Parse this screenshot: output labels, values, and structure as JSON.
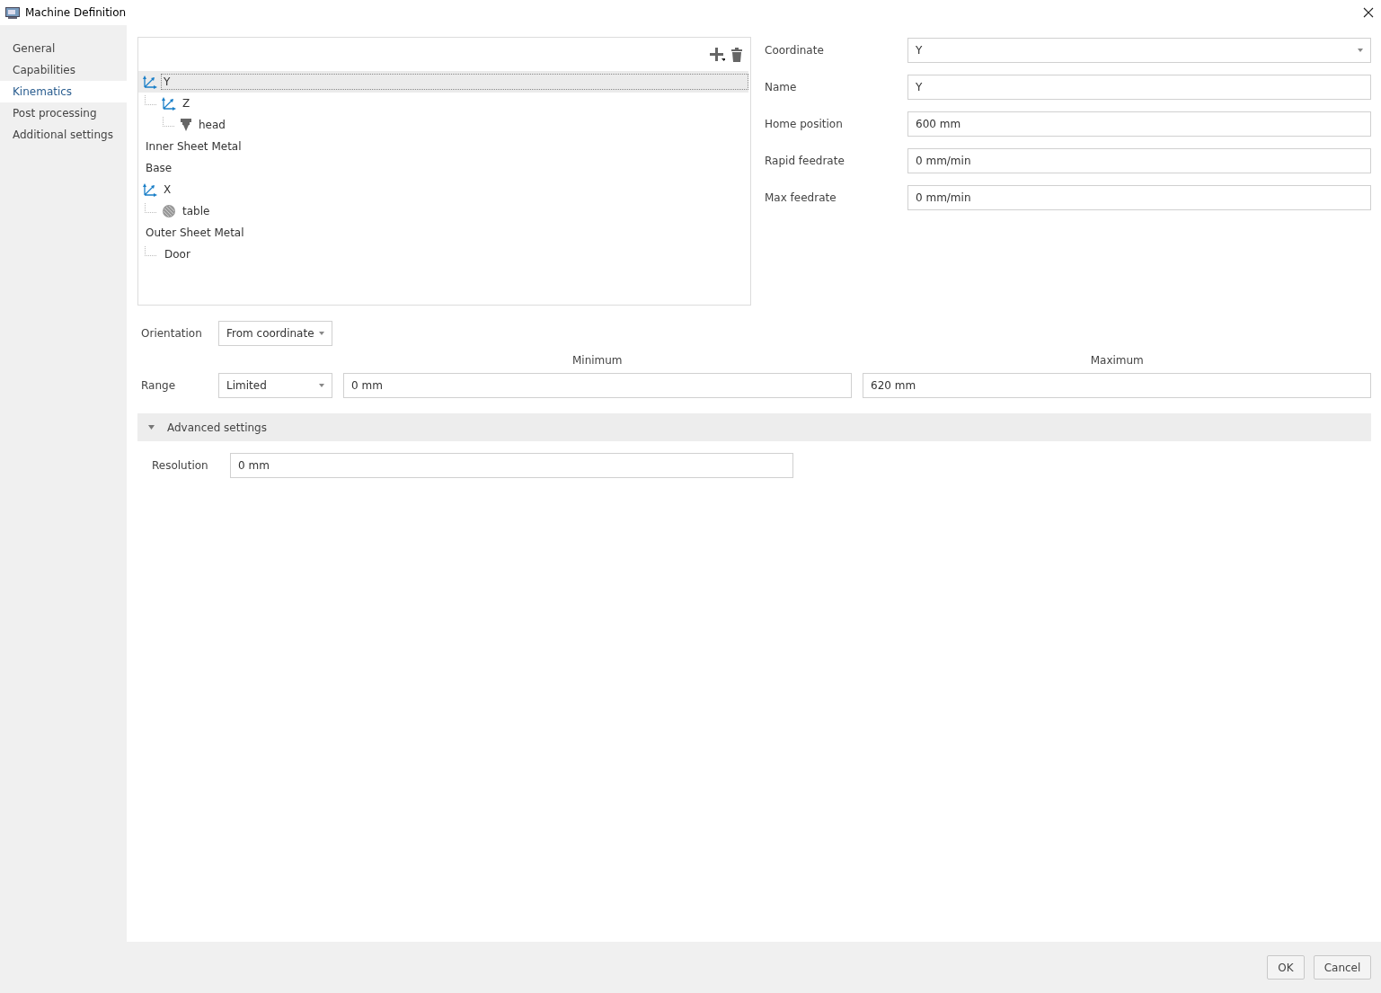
{
  "window": {
    "title": "Machine Definition"
  },
  "sidebar": {
    "items": [
      {
        "label": "General",
        "selected": false
      },
      {
        "label": "Capabilities",
        "selected": false
      },
      {
        "label": "Kinematics",
        "selected": true
      },
      {
        "label": "Post processing",
        "selected": false
      },
      {
        "label": "Additional settings",
        "selected": false
      }
    ]
  },
  "tree": {
    "items": [
      {
        "label": "Y",
        "kind": "axis",
        "selected": true,
        "children": [
          {
            "label": "Z",
            "kind": "axis",
            "selected": false,
            "children": [
              {
                "label": "head",
                "kind": "head",
                "selected": false
              }
            ]
          }
        ]
      },
      {
        "label": "Inner Sheet Metal",
        "kind": "plain",
        "selected": false
      },
      {
        "label": "Base",
        "kind": "plain",
        "selected": false
      },
      {
        "label": "X",
        "kind": "axis",
        "selected": false,
        "children": [
          {
            "label": "table",
            "kind": "table",
            "selected": false
          }
        ]
      },
      {
        "label": "Outer Sheet Metal",
        "kind": "plain",
        "selected": false,
        "children": [
          {
            "label": "Door",
            "kind": "plain",
            "selected": false
          }
        ]
      }
    ]
  },
  "properties": [
    {
      "label": "Coordinate",
      "value": "Y",
      "kind": "select"
    },
    {
      "label": "Name",
      "value": "Y",
      "kind": "text"
    },
    {
      "label": "Home position",
      "value": "600 mm",
      "kind": "text"
    },
    {
      "label": "Rapid feedrate",
      "value": "0 mm/min",
      "kind": "text"
    },
    {
      "label": "Max feedrate",
      "value": "0 mm/min",
      "kind": "text"
    }
  ],
  "orientation": {
    "label": "Orientation",
    "value": "From coordinate"
  },
  "range": {
    "label": "Range",
    "value": "Limited",
    "minimum_header": "Minimum",
    "maximum_header": "Maximum",
    "minimum": "0 mm",
    "maximum": "620 mm"
  },
  "advanced_settings": {
    "title": "Advanced settings",
    "expanded": true,
    "resolution_label": "Resolution",
    "resolution": "0 mm"
  },
  "buttons": [
    "OK",
    "Cancel"
  ]
}
